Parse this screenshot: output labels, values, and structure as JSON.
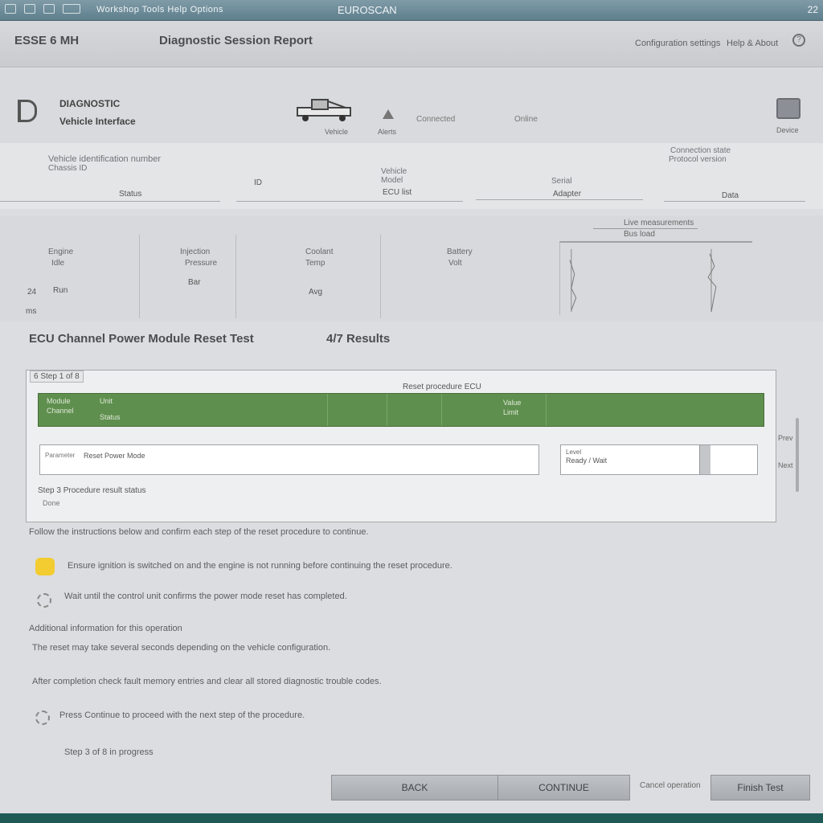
{
  "window": {
    "title": "EUROSCAN",
    "menu": "Workshop Tools Help Options",
    "corner_text": "22"
  },
  "header": {
    "app_name": "ESSE 6 MH",
    "doc_title": "Diagnostic Session Report",
    "link1": "Configuration settings",
    "link2": "Help & About"
  },
  "brand": {
    "line1": "DIAGNOSTIC",
    "line2": "Vehicle Interface",
    "truck_label": "Vehicle",
    "warn_label": "Alerts",
    "text1": "Connected",
    "text2": "Online",
    "device_label": "Device"
  },
  "fields": [
    {
      "label": "Vehicle identification number",
      "sub": "Chassis ID",
      "value": "Status"
    },
    {
      "label": "",
      "sub": "",
      "value": "ID"
    },
    {
      "label": "Vehicle",
      "sub": "Model",
      "value": "ECU list"
    },
    {
      "label": "Serial",
      "sub": "",
      "value": "Adapter"
    },
    {
      "label": "Connection state",
      "sub": "Protocol version",
      "value": "Data"
    }
  ],
  "stats": {
    "header": "Live measurements",
    "subheader": "Bus load",
    "columns": [
      {
        "label": "Engine",
        "sub": "Idle",
        "value": "Run"
      },
      {
        "label": "Injection",
        "sub": "Pressure",
        "value": "Bar"
      },
      {
        "label": "Coolant",
        "sub": "Temp",
        "value": "Avg"
      },
      {
        "label": "Battery",
        "sub": "Volt",
        "value": ""
      }
    ],
    "left_value": "24",
    "left_unit": "ms"
  },
  "section": {
    "title": "ECU Channel Power Module Reset Test",
    "subtitle": "4/7 Results"
  },
  "panel": {
    "tag": "6 Step 1 of 8",
    "heading": "Reset procedure ECU",
    "green_cells": [
      {
        "a": "Module",
        "b": "Unit",
        "c": "Channel",
        "d": "Status"
      },
      {
        "a": "Value",
        "b": "Limit"
      }
    ],
    "input_label": "Parameter",
    "input_value": "Reset Power Mode",
    "side_label": "Level",
    "side_value": "Ready / Wait",
    "foot1": "Step 3 Procedure result status",
    "foot2": "Done"
  },
  "scroll": {
    "up": "Prev",
    "down": "Next"
  },
  "info": {
    "intro": "Follow the instructions below and confirm each step of the reset procedure to continue.",
    "warning": "Ensure ignition is switched on and the engine is not running before continuing the reset procedure.",
    "note": "Wait until the control unit confirms the power mode reset has completed.",
    "heading2": "Additional information for this operation",
    "text2": "The reset may take several seconds depending on the vehicle configuration.",
    "text3": "After completion check fault memory entries and clear all stored diagnostic trouble codes.",
    "tip": "Press Continue to proceed with the next step of the procedure.",
    "tip2": "Step 3 of 8 in progress"
  },
  "buttons": {
    "back": "BACK",
    "continue": "CONTINUE",
    "finish": "Finish Test",
    "link": "Cancel operation"
  },
  "colors": {
    "green": "#5f8f4e",
    "titlebar": "#6f8d9a",
    "warning_yellow": "#f2cc30"
  }
}
